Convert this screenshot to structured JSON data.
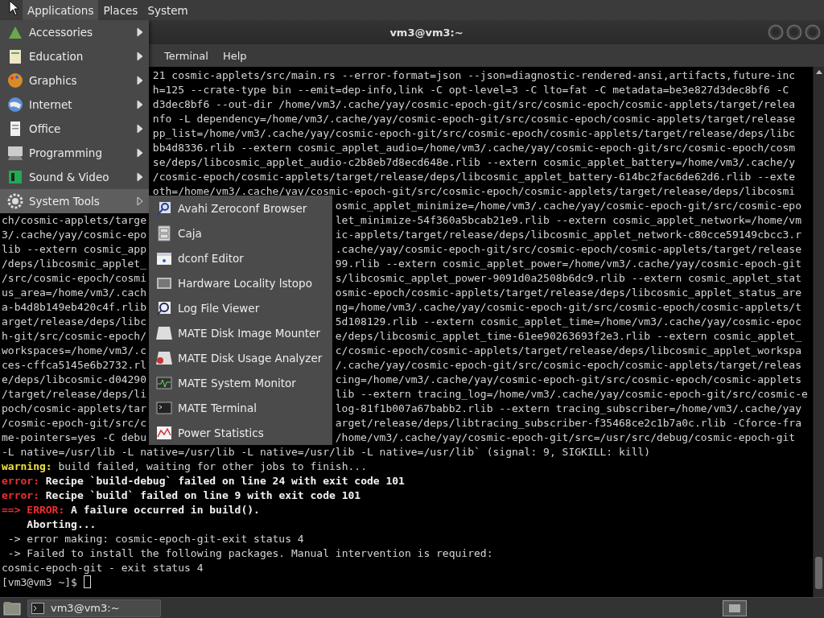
{
  "top_panel": {
    "menus": [
      {
        "label": "Applications",
        "selected": true
      },
      {
        "label": "Places",
        "selected": false
      },
      {
        "label": "System",
        "selected": false
      }
    ]
  },
  "window": {
    "title": "vm3@vm3:~",
    "menus": [
      "Terminal",
      "Help"
    ]
  },
  "terminal": {
    "lines_above_menu": [
      "21 cosmic-applets/src/main.rs --error-format=json --json=diagnostic-rendered-ansi,artifacts,future-inc",
      "h=125 --crate-type bin --emit=dep-info,link -C opt-level=3 -C lto=fat -C metadata=be3e827d3dec8bf6 -C",
      "d3dec8bf6 --out-dir /home/vm3/.cache/yay/cosmic-epoch-git/src/cosmic-epoch/cosmic-applets/target/relea",
      "nfo -L dependency=/home/vm3/.cache/yay/cosmic-epoch-git/src/cosmic-epoch/cosmic-applets/target/release",
      "pp_list=/home/vm3/.cache/yay/cosmic-epoch-git/src/cosmic-epoch/cosmic-applets/target/release/deps/libc",
      "bb4d8336.rlib --extern cosmic_applet_audio=/home/vm3/.cache/yay/cosmic-epoch-git/src/cosmic-epoch/cosm",
      "se/deps/libcosmic_applet_audio-c2b8eb7d8ecd648e.rlib --extern cosmic_applet_battery=/home/vm3/.cache/y",
      "/cosmic-epoch/cosmic-applets/target/release/deps/libcosmic_applet_battery-614bc2fac6de62d6.rlib --exte",
      "oth=/home/vm3/.cache/yay/cosmic-epoch-git/src/cosmic-epoch/cosmic-applets/target/release/deps/libcosmi"
    ],
    "lines_beside_menu": [
      {
        "right": "osmic_applet_minimize=/home/vm3/.cache/yay/cosmic-epoch-git/src/cosmic-epo"
      },
      {
        "left": "ch/cosmic-applets/targe",
        "right": "let_minimize-54f360a5bcab21e9.rlib --extern cosmic_applet_network=/home/vm"
      },
      {
        "left": "3/.cache/yay/cosmic-epo",
        "right": "ic-applets/target/release/deps/libcosmic_applet_network-c80cce59149cbcc3.r"
      },
      {
        "left": "lib --extern cosmic_app",
        "right": ".cache/yay/cosmic-epoch-git/src/cosmic-epoch/cosmic-applets/target/release"
      },
      {
        "left": "/deps/libcosmic_applet_",
        "right": "99.rlib --extern cosmic_applet_power=/home/vm3/.cache/yay/cosmic-epoch-git"
      },
      {
        "left": "/src/cosmic-epoch/cosmi",
        "right": "s/libcosmic_applet_power-9091d0a2508b6dc9.rlib --extern cosmic_applet_stat"
      },
      {
        "left": "us_area=/home/vm3/.cach",
        "right": "osmic-epoch/cosmic-applets/target/release/deps/libcosmic_applet_status_are"
      },
      {
        "left": "a-b4d8b149eb420c4f.rlib",
        "right": "ng=/home/vm3/.cache/yay/cosmic-epoch-git/src/cosmic-epoch/cosmic-applets/t"
      },
      {
        "left": "arget/release/deps/libc",
        "right": "5d108129.rlib --extern cosmic_applet_time=/home/vm3/.cache/yay/cosmic-epoc"
      },
      {
        "left": "h-git/src/cosmic-epoch/",
        "right": "e/deps/libcosmic_applet_time-61ee90263693f2e3.rlib --extern cosmic_applet_"
      },
      {
        "left": "workspaces=/home/vm3/.c",
        "right": "c/cosmic-epoch/cosmic-applets/target/release/deps/libcosmic_applet_workspa"
      },
      {
        "left": "ces-cffca5145e6b2732.rl",
        "right": "/.cache/yay/cosmic-epoch-git/src/cosmic-epoch/cosmic-applets/target/releas"
      },
      {
        "left": "e/deps/libcosmic-d04290",
        "right": "cing=/home/vm3/.cache/yay/cosmic-epoch-git/src/cosmic-epoch/cosmic-applets"
      },
      {
        "left": "/target/release/deps/li",
        "right": "lib --extern tracing_log=/home/vm3/.cache/yay/cosmic-epoch-git/src/cosmic-e"
      },
      {
        "left": "poch/cosmic-applets/tar",
        "right": "log-81f1b007a67babb2.rlib --extern tracing_subscriber=/home/vm3/.cache/yay"
      },
      {
        "left": "/cosmic-epoch-git/src/c",
        "right": "arget/release/deps/libtracing_subscriber-f35468ce2c1b7a0c.rlib -Cforce-fra"
      },
      {
        "left": "me-pointers=yes -C debu",
        "right": "/home/vm3/.cache/yay/cosmic-epoch-git/src=/usr/src/debug/cosmic-epoch-git"
      }
    ],
    "lines_below_menu": [
      {
        "segments": [
          {
            "kind": "plain",
            "text": "-L native=/usr/lib -L native=/usr/lib -L native=/usr/lib -L native=/usr/lib` (signal: 9, SIGKILL: kill)"
          }
        ]
      },
      {
        "segments": [
          {
            "kind": "warning",
            "text": "warning:"
          },
          {
            "kind": "plain",
            "text": " build failed, waiting for other jobs to finish..."
          }
        ]
      },
      {
        "segments": [
          {
            "kind": "error",
            "text": "error:"
          },
          {
            "kind": "bold",
            "text": " Recipe `build-debug` failed on line 24 with exit code 101"
          }
        ]
      },
      {
        "segments": [
          {
            "kind": "error",
            "text": "error:"
          },
          {
            "kind": "bold",
            "text": " Recipe `build` failed on line 9 with exit code 101"
          }
        ]
      },
      {
        "segments": [
          {
            "kind": "error",
            "text": "==> ERROR:"
          },
          {
            "kind": "bold",
            "text": " A failure occurred in build()."
          }
        ]
      },
      {
        "segments": [
          {
            "kind": "bold",
            "text": "    Aborting..."
          }
        ]
      },
      {
        "segments": [
          {
            "kind": "plain",
            "text": " -> error making: cosmic-epoch-git-exit status 4"
          }
        ]
      },
      {
        "segments": [
          {
            "kind": "plain",
            "text": " -> Failed to install the following packages. Manual intervention is required:"
          }
        ]
      },
      {
        "segments": [
          {
            "kind": "plain",
            "text": "cosmic-epoch-git - exit status 4"
          }
        ]
      }
    ],
    "prompt": "[vm3@vm3 ~]$"
  },
  "applications_menu": {
    "items": [
      {
        "label": "Accessories",
        "selected": false
      },
      {
        "label": "Education",
        "selected": false
      },
      {
        "label": "Graphics",
        "selected": false
      },
      {
        "label": "Internet",
        "selected": false
      },
      {
        "label": "Office",
        "selected": false
      },
      {
        "label": "Programming",
        "selected": false
      },
      {
        "label": "Sound & Video",
        "selected": false
      },
      {
        "label": "System Tools",
        "selected": true
      }
    ]
  },
  "submenu": {
    "items": [
      "Avahi Zeroconf Browser",
      "Caja",
      "dconf Editor",
      "Hardware Locality lstopo",
      "Log File Viewer",
      "MATE Disk Image Mounter",
      "MATE Disk Usage Analyzer",
      "MATE System Monitor",
      "MATE Terminal",
      "Power Statistics"
    ]
  },
  "bottom_panel": {
    "tasks": [
      "vm3@vm3:~"
    ]
  }
}
